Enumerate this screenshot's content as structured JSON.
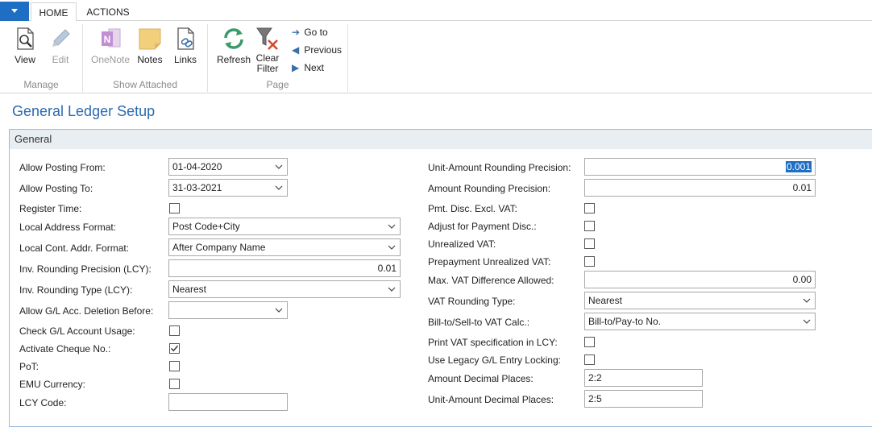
{
  "tabs": {
    "home": "HOME",
    "actions": "ACTIONS"
  },
  "ribbon": {
    "manage": {
      "label": "Manage",
      "view": "View",
      "edit": "Edit"
    },
    "show_attached": {
      "label": "Show Attached",
      "onenote": "OneNote",
      "notes": "Notes",
      "links": "Links"
    },
    "page": {
      "label": "Page",
      "refresh": "Refresh",
      "clear_filter_1": "Clear",
      "clear_filter_2": "Filter",
      "go_to": "Go to",
      "previous": "Previous",
      "next": "Next"
    }
  },
  "page_title": "General Ledger Setup",
  "fasttab_title": "General",
  "left": {
    "allow_posting_from": {
      "label": "Allow Posting From:",
      "value": "01-04-2020"
    },
    "allow_posting_to": {
      "label": "Allow Posting To:",
      "value": "31-03-2021"
    },
    "register_time": {
      "label": "Register Time:",
      "checked": false
    },
    "local_address_format": {
      "label": "Local Address Format:",
      "value": "Post Code+City"
    },
    "local_cont_addr_format": {
      "label": "Local Cont. Addr. Format:",
      "value": "After Company Name"
    },
    "inv_rounding_precision": {
      "label": "Inv. Rounding Precision (LCY):",
      "value": "0.01"
    },
    "inv_rounding_type": {
      "label": "Inv. Rounding Type (LCY):",
      "value": "Nearest"
    },
    "allow_gl_deletion": {
      "label": "Allow G/L Acc. Deletion Before:",
      "value": ""
    },
    "check_gl_usage": {
      "label": "Check G/L Account Usage:",
      "checked": false
    },
    "activate_cheque": {
      "label": "Activate Cheque No.:",
      "checked": true
    },
    "pot": {
      "label": "PoT:",
      "checked": false
    },
    "emu_currency": {
      "label": "EMU Currency:",
      "checked": false
    },
    "lcy_code": {
      "label": "LCY Code:",
      "value": ""
    }
  },
  "right": {
    "unit_amount_rounding": {
      "label": "Unit-Amount Rounding Precision:",
      "value": "0.001"
    },
    "amount_rounding": {
      "label": "Amount Rounding Precision:",
      "value": "0.01"
    },
    "pmt_disc_excl_vat": {
      "label": "Pmt. Disc. Excl. VAT:",
      "checked": false
    },
    "adjust_payment_disc": {
      "label": "Adjust for Payment Disc.:",
      "checked": false
    },
    "unrealized_vat": {
      "label": "Unrealized VAT:",
      "checked": false
    },
    "prepayment_unrealized_vat": {
      "label": "Prepayment Unrealized VAT:",
      "checked": false
    },
    "max_vat_difference": {
      "label": "Max. VAT Difference Allowed:",
      "value": "0.00"
    },
    "vat_rounding_type": {
      "label": "VAT Rounding Type:",
      "value": "Nearest"
    },
    "bill_to_sell_to": {
      "label": "Bill-to/Sell-to VAT Calc.:",
      "value": "Bill-to/Pay-to No."
    },
    "print_vat_spec": {
      "label": "Print VAT specification in LCY:",
      "checked": false
    },
    "legacy_gl_locking": {
      "label": "Use Legacy G/L Entry Locking:",
      "checked": false
    },
    "amount_decimal_places": {
      "label": "Amount Decimal Places:",
      "value": "2:2"
    },
    "unit_amount_decimal_places": {
      "label": "Unit-Amount Decimal Places:",
      "value": "2:5"
    }
  },
  "colors": {
    "accent": "#1e6fc4",
    "title": "#2a6ab1",
    "fasttab_bg": "#e9eef3"
  }
}
